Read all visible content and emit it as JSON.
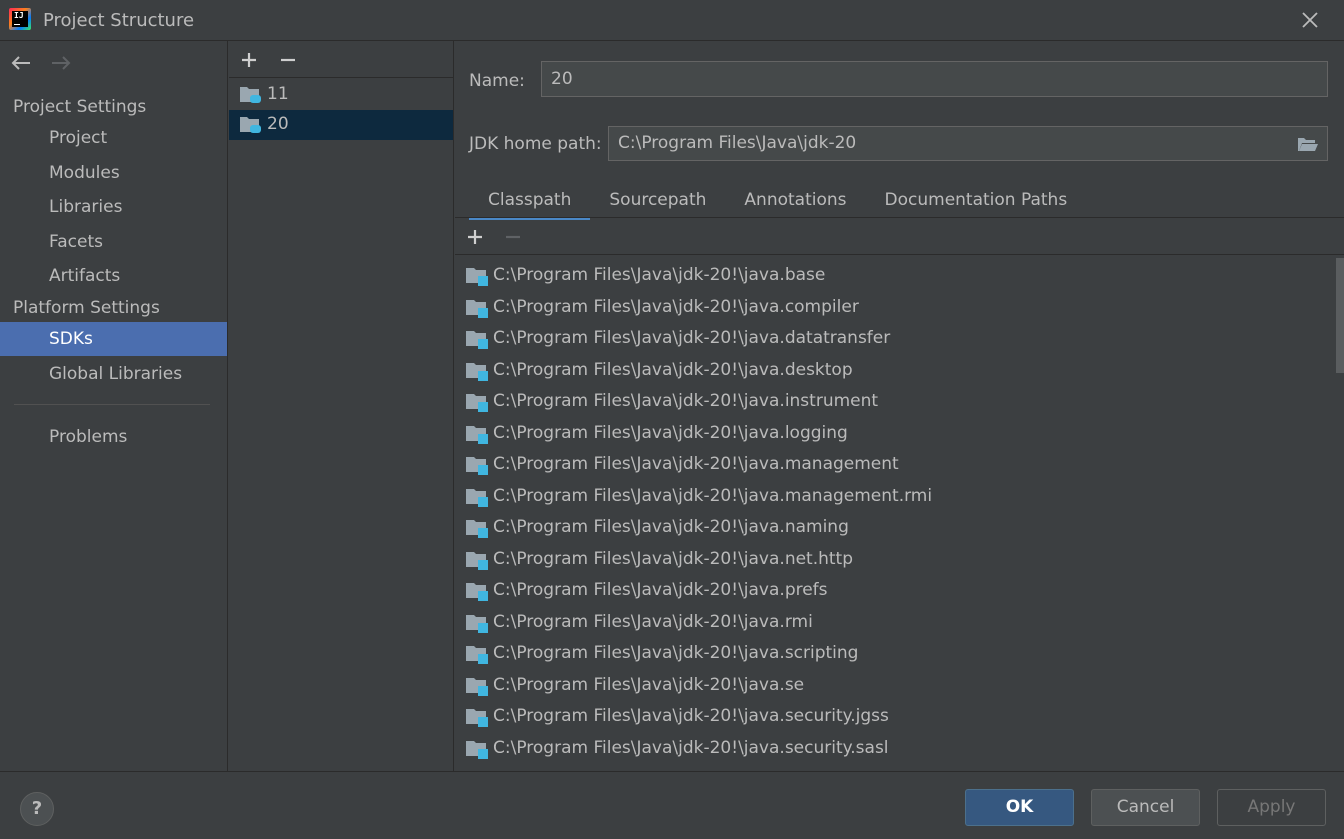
{
  "window": {
    "title": "Project Structure"
  },
  "nav": {
    "project_settings_header": "Project Settings",
    "project_items": [
      "Project",
      "Modules",
      "Libraries",
      "Facets",
      "Artifacts"
    ],
    "platform_settings_header": "Platform Settings",
    "platform_items": [
      "SDKs",
      "Global Libraries"
    ],
    "problems": "Problems",
    "selected": "SDKs"
  },
  "sdk_list": {
    "items": [
      "11",
      "20"
    ],
    "selected": "20"
  },
  "sdk_detail": {
    "name_label": "Name:",
    "name_value": "20",
    "home_label": "JDK home path:",
    "home_value": "C:\\Program Files\\Java\\jdk-20",
    "tabs": [
      "Classpath",
      "Sourcepath",
      "Annotations",
      "Documentation Paths"
    ],
    "active_tab": "Classpath",
    "classpath": [
      "C:\\Program Files\\Java\\jdk-20!\\java.base",
      "C:\\Program Files\\Java\\jdk-20!\\java.compiler",
      "C:\\Program Files\\Java\\jdk-20!\\java.datatransfer",
      "C:\\Program Files\\Java\\jdk-20!\\java.desktop",
      "C:\\Program Files\\Java\\jdk-20!\\java.instrument",
      "C:\\Program Files\\Java\\jdk-20!\\java.logging",
      "C:\\Program Files\\Java\\jdk-20!\\java.management",
      "C:\\Program Files\\Java\\jdk-20!\\java.management.rmi",
      "C:\\Program Files\\Java\\jdk-20!\\java.naming",
      "C:\\Program Files\\Java\\jdk-20!\\java.net.http",
      "C:\\Program Files\\Java\\jdk-20!\\java.prefs",
      "C:\\Program Files\\Java\\jdk-20!\\java.rmi",
      "C:\\Program Files\\Java\\jdk-20!\\java.scripting",
      "C:\\Program Files\\Java\\jdk-20!\\java.se",
      "C:\\Program Files\\Java\\jdk-20!\\java.security.jgss",
      "C:\\Program Files\\Java\\jdk-20!\\java.security.sasl"
    ]
  },
  "buttons": {
    "ok": "OK",
    "cancel": "Cancel",
    "apply": "Apply",
    "help": "?"
  },
  "colors": {
    "accent": "#4b6eaf",
    "selection_dark": "#0d293e",
    "ok_button": "#365880",
    "background": "#3c3f41"
  }
}
